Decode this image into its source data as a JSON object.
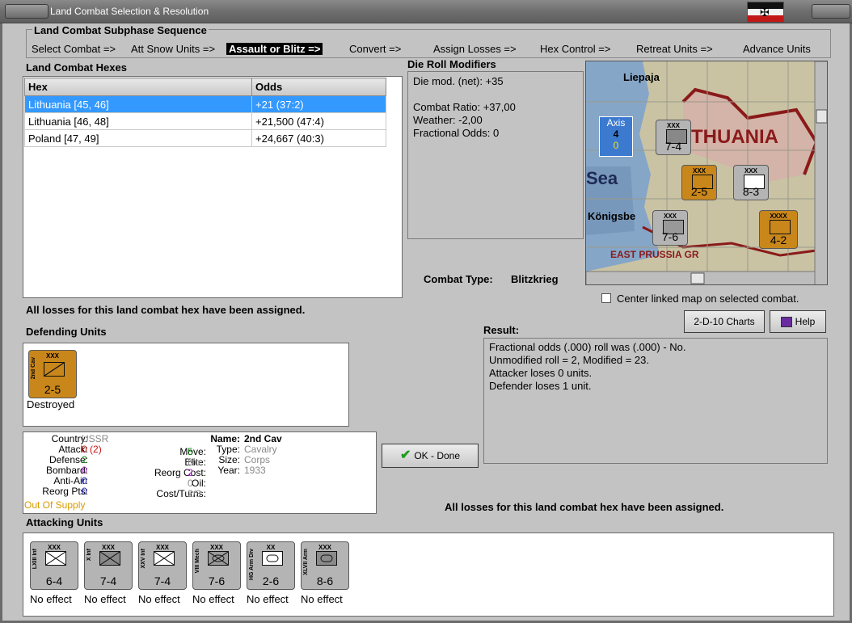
{
  "window": {
    "title": "Land Combat Selection & Resolution"
  },
  "sequence": {
    "heading": "Land Combat Subphase Sequence",
    "steps": [
      "Select Combat =>",
      "Att Snow Units =>",
      "Assault or Blitz =>",
      "Convert =>",
      "Assign Losses =>",
      "Hex Control =>",
      "Retreat Units =>",
      "Advance Units"
    ],
    "active_index": 2
  },
  "hexes": {
    "heading": "Land Combat Hexes",
    "columns": [
      "Hex",
      "Odds"
    ],
    "rows": [
      {
        "hex": "Lithuania [45, 46]",
        "odds": "+21 (37:2)"
      },
      {
        "hex": "Lithuania [46, 48]",
        "odds": "+21,500 (47:4)"
      },
      {
        "hex": "Poland [47, 49]",
        "odds": "+24,667 (40:3)"
      }
    ],
    "selected_index": 0
  },
  "modifiers": {
    "heading": "Die Roll Modifiers",
    "lines": [
      "Die mod. (net): +35",
      "",
      "Combat Ratio: +37,00",
      "Weather: -2,00",
      "Fractional Odds: 0"
    ]
  },
  "combat_type": {
    "label": "Combat Type:",
    "value": "Blitzkrieg"
  },
  "map": {
    "labels": [
      "Liepaja",
      "Axis",
      "4",
      "0",
      "THUANIA",
      "Sea",
      "Königsbe",
      "EAST PRUSSIA GR"
    ],
    "center_checkbox_label": "Center linked map on selected combat.",
    "counters": [
      {
        "corps": "XXX",
        "name": "X Inf",
        "str": "7-4"
      },
      {
        "corps": "XXX",
        "name": "",
        "str": "2-5"
      },
      {
        "corps": "XXX",
        "name": "",
        "str": "8-3"
      },
      {
        "corps": "XXX",
        "name": "VIII Mech",
        "str": "7-6"
      },
      {
        "corps": "XXXX",
        "name": "",
        "str": "4-2"
      }
    ]
  },
  "status_top": "All losses for this land combat hex have been assigned.",
  "buttons": {
    "charts": "2-D-10 Charts",
    "help": "Help",
    "ok": "OK - Done"
  },
  "defending": {
    "heading": "Defending Units",
    "units": [
      {
        "corps": "XXX",
        "name": "2nd Cav",
        "str": "2-5",
        "status": "Destroyed"
      }
    ]
  },
  "result": {
    "heading": "Result:",
    "lines": [
      "Fractional odds (.000) roll was (.000)  - No.",
      "Unmodified roll = 2, Modified = 23.",
      "Attacker loses 0 units.",
      "Defender loses 1 unit."
    ]
  },
  "unit_info": {
    "country_label": "Country:",
    "country": "USSR",
    "attack_label": "Attack:",
    "attack": "0",
    "attack_extra": "(2)",
    "defense_label": "Defense:",
    "defense": "2",
    "bombard_label": "Bombard:",
    "bombard": "0",
    "antiair_label": "Anti-Air:",
    "antiair": "0",
    "reorgpts_label": "Reorg Pts:",
    "reorgpts": "0",
    "supply": "Out Of Supply",
    "move_label": "Move:",
    "move": "5",
    "elite_label": "Elite:",
    "elite": "No",
    "reorgcost_label": "Reorg Cost:",
    "reorgcost": "2",
    "oil_label": "Oil:",
    "oil": "0",
    "costturns_label": "Cost/Turns:",
    "costturns": "2/3",
    "name_label": "Name:",
    "name": "2nd Cav",
    "type_label": "Type:",
    "type": "Cavalry",
    "size_label": "Size:",
    "size": "Corps",
    "year_label": "Year:",
    "year": "1933"
  },
  "status_bottom": "All losses for this land combat hex have been assigned.",
  "attacking": {
    "heading": "Attacking Units",
    "units": [
      {
        "corps": "XXX",
        "name": "LXIII Inf",
        "str": "6-4",
        "status": "No effect",
        "symbol": "inf"
      },
      {
        "corps": "XXX",
        "name": "X Inf",
        "str": "7-4",
        "status": "No effect",
        "symbol": "inf-dark"
      },
      {
        "corps": "XXX",
        "name": "XXV Inf",
        "str": "7-4",
        "status": "No effect",
        "symbol": "inf"
      },
      {
        "corps": "XXX",
        "name": "VIII Mech",
        "str": "7-6",
        "status": "No effect",
        "symbol": "mech"
      },
      {
        "corps": "XX",
        "name": "HG Arm Div",
        "str": "2-6",
        "status": "No effect",
        "symbol": "arm"
      },
      {
        "corps": "XXX",
        "name": "XLVII Arm",
        "str": "8-6",
        "status": "No effect",
        "symbol": "arm-dark"
      }
    ]
  },
  "colors": {
    "highlight": "#3399ff",
    "soviet_counter": "#c8861b",
    "german_counter": "#b4b4b4",
    "supply": "#d89a00",
    "blue_value": "#1c1cc0",
    "green_value": "#138a13",
    "red_value": "#d01010",
    "purple_value": "#a020c0"
  }
}
